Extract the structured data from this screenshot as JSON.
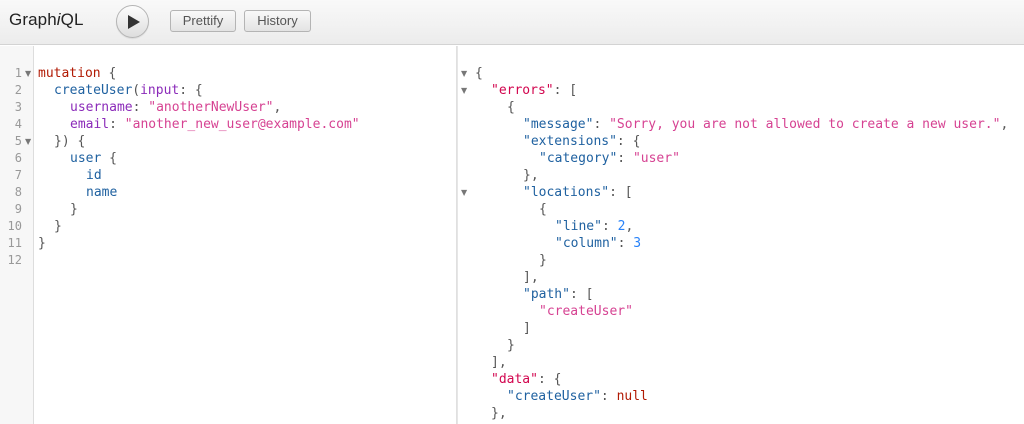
{
  "toolbar": {
    "title_prefix": "Graph",
    "title_italic": "i",
    "title_suffix": "QL",
    "prettify_label": "Prettify",
    "history_label": "History"
  },
  "query_editor": {
    "line_numbers": [
      "1",
      "2",
      "3",
      "4",
      "5",
      "6",
      "7",
      "8",
      "9",
      "10",
      "11",
      "12"
    ],
    "lines": [
      [
        "mutation",
        " {"
      ],
      [
        "createUser",
        "(",
        "input",
        ": {"
      ],
      [
        "username",
        ": ",
        "\"anotherNewUser\"",
        ","
      ],
      [
        "email",
        ": ",
        "\"another_new_user@example.com\""
      ],
      [
        "}) {"
      ],
      [
        "user",
        " {"
      ],
      [
        "id"
      ],
      [
        "name"
      ],
      [
        "}"
      ],
      [
        "}"
      ],
      [
        "}"
      ],
      [
        ""
      ]
    ]
  },
  "result_viewer": {
    "lines": [
      [
        "{"
      ],
      [
        "\"errors\"",
        ": ["
      ],
      [
        "{"
      ],
      [
        "\"message\"",
        ": ",
        "\"Sorry, you are not allowed to create a new user.\"",
        ","
      ],
      [
        "\"extensions\"",
        ": {"
      ],
      [
        "\"category\"",
        ": ",
        "\"user\""
      ],
      [
        "},"
      ],
      [
        "\"locations\"",
        ": ["
      ],
      [
        "{"
      ],
      [
        "\"line\"",
        ": ",
        "2",
        ","
      ],
      [
        "\"column\"",
        ": ",
        "3"
      ],
      [
        "}"
      ],
      [
        "],"
      ],
      [
        "\"path\"",
        ": ["
      ],
      [
        "\"createUser\""
      ],
      [
        "]"
      ],
      [
        "}"
      ],
      [
        "],"
      ],
      [
        "\"data\"",
        ": {"
      ],
      [
        "\"createUser\"",
        ": ",
        "null"
      ],
      [
        "},"
      ]
    ]
  }
}
